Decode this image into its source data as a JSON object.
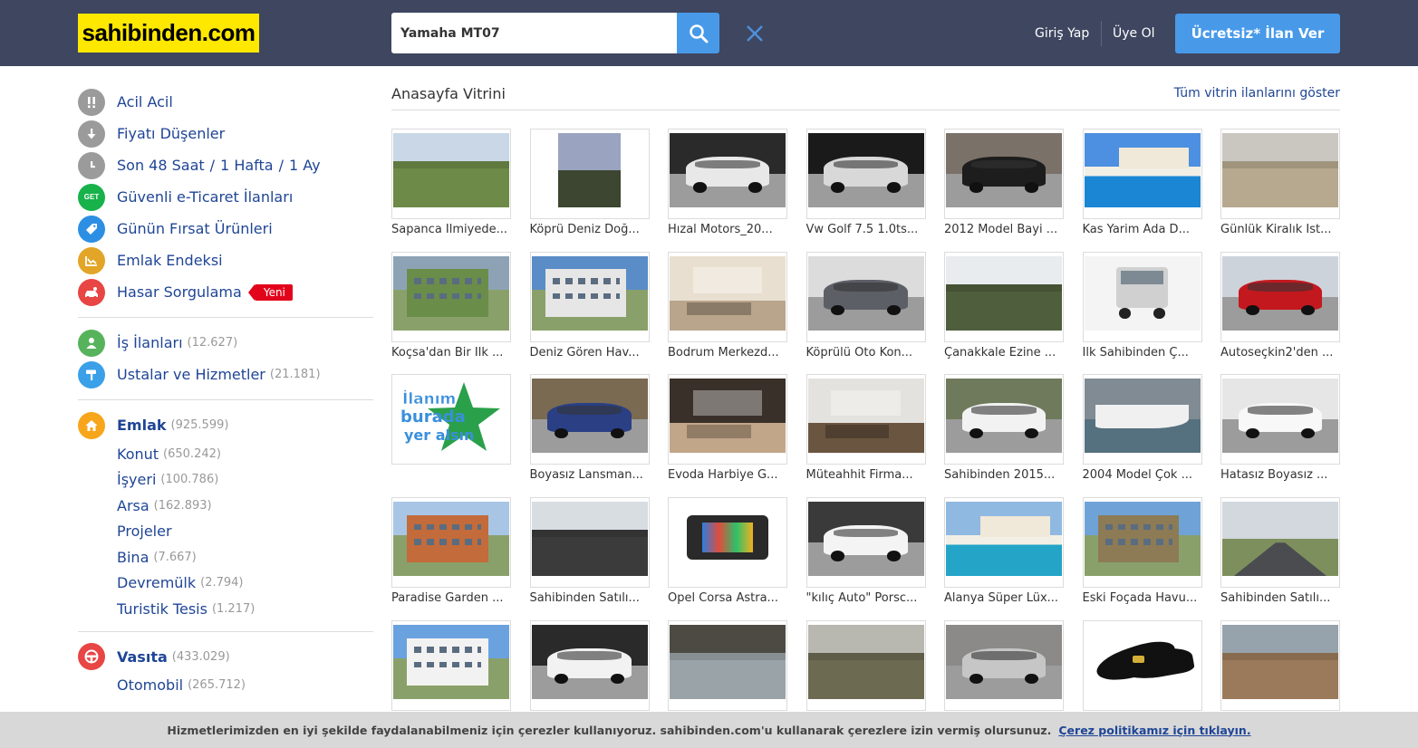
{
  "header": {
    "logo_text": "sahibinden.com",
    "search_value": "Yamaha MT07",
    "login_label": "Giriş Yap",
    "register_label": "Üye Ol",
    "cta_label": "Ücretsiz* İlan Ver"
  },
  "sidebar": {
    "quick_links": [
      {
        "label": "Acil Acil",
        "icon": "exclamation-icon",
        "color": "#9b9b9b"
      },
      {
        "label": "Fiyatı Düşenler",
        "icon": "arrow-down-icon",
        "color": "#9b9b9b"
      },
      {
        "label": "Son 48 Saat",
        "label2": "1 Hafta",
        "label3": "1 Ay",
        "icon": "clock-icon",
        "color": "#9b9b9b"
      },
      {
        "label": "Güvenli e-Ticaret İlanları",
        "icon": "get-icon",
        "icon_text": "GET",
        "color": "#17b24a"
      },
      {
        "label": "Günün Fırsat Ürünleri",
        "icon": "tag-icon",
        "color": "#2d8fe4"
      },
      {
        "label": "Emlak Endeksi",
        "icon": "chart-icon",
        "color": "#e2a527"
      },
      {
        "label": "Hasar Sorgulama",
        "icon": "car-damage-icon",
        "color": "#e84545",
        "badge": "Yeni"
      }
    ],
    "services": [
      {
        "label": "İş İlanları",
        "count": "(12.627)",
        "icon": "person-icon",
        "color": "#56b35c"
      },
      {
        "label": "Ustalar ve Hizmetler",
        "count": "(21.181)",
        "icon": "paint-roller-icon",
        "color": "#3aa0e8"
      }
    ],
    "emlak": {
      "label": "Emlak",
      "count": "(925.599)",
      "icon": "house-icon",
      "color": "#f7a61c",
      "subs": [
        {
          "label": "Konut",
          "count": "(650.242)"
        },
        {
          "label": "İşyeri",
          "count": "(100.786)"
        },
        {
          "label": "Arsa",
          "count": "(162.893)"
        },
        {
          "label": "Projeler",
          "count": ""
        },
        {
          "label": "Bina",
          "count": "(7.667)"
        },
        {
          "label": "Devremülk",
          "count": "(2.794)"
        },
        {
          "label": "Turistik Tesis",
          "count": "(1.217)"
        }
      ]
    },
    "vasita": {
      "label": "Vasıta",
      "count": "(433.029)",
      "icon": "steering-wheel-icon",
      "color": "#e84545",
      "subs": [
        {
          "label": "Otomobil",
          "count": "(265.712)"
        }
      ]
    }
  },
  "vitrin": {
    "title": "Anasayfa Vitrini",
    "show_all": "Tüm vitrin ilanlarını göster",
    "rows": [
      [
        {
          "title": "Sapanca Ilmiyede...",
          "kind": "land",
          "c1": "#c9d7e6",
          "c2": "#6d8a48"
        },
        {
          "title": "Köprü Deniz Doğ...",
          "kind": "sky",
          "c1": "#9aa3c0",
          "c2": "#3c4630"
        },
        {
          "title": "Hızal Motors_20...",
          "kind": "car",
          "c1": "#2a2a2a",
          "c2": "#e8e8e8"
        },
        {
          "title": "Vw Golf 7.5 1.0ts...",
          "kind": "car",
          "c1": "#1a1a1a",
          "c2": "#d8d8d8"
        },
        {
          "title": "2012 Model Bayi ...",
          "kind": "car",
          "c1": "#7a7168",
          "c2": "#1d1d1d"
        },
        {
          "title": "Kas Yarim Ada D...",
          "kind": "pool",
          "c1": "#4d8fe0",
          "c2": "#1a86d4"
        },
        {
          "title": "Günlük Kiralık İst...",
          "kind": "land",
          "c1": "#c9c7c0",
          "c2": "#b7a98f"
        }
      ],
      [
        {
          "title": "Koçsa'dan Bir Ilk ...",
          "kind": "building",
          "c1": "#8da3b5",
          "c2": "#6b8d4a"
        },
        {
          "title": "Deniz Gören Hav...",
          "kind": "building",
          "c1": "#5a8cc7",
          "c2": "#e6e6e6"
        },
        {
          "title": "Bodrum Merkezd...",
          "kind": "interior",
          "c1": "#e8dfd0",
          "c2": "#b9a58b"
        },
        {
          "title": "Köprülü Oto Kon...",
          "kind": "car",
          "c1": "#dcdcdc",
          "c2": "#5c5f66"
        },
        {
          "title": "Çanakkale Ezine ...",
          "kind": "land",
          "c1": "#e8ecef",
          "c2": "#4f5e3c"
        },
        {
          "title": "Ilk Sahibinden Ç...",
          "kind": "truck",
          "c1": "#f4f4f4",
          "c2": "#d0d0d0"
        },
        {
          "title": "Autoseçkin2'den ...",
          "kind": "car",
          "c1": "#cdd3da",
          "c2": "#c4181f"
        }
      ],
      [
        {
          "title": "",
          "kind": "placeholder",
          "c1": "#ffffff",
          "c2": "#2aa04a",
          "placeholder_lines": [
            "İlanım",
            "burada",
            "yer alsın"
          ]
        },
        {
          "title": "Boyasız Lansman...",
          "kind": "car",
          "c1": "#7a6a52",
          "c2": "#2a3f84"
        },
        {
          "title": "Evoda Harbiye G...",
          "kind": "interior",
          "c1": "#3a302a",
          "c2": "#c2a689"
        },
        {
          "title": "Müteahhit Firma...",
          "kind": "interior",
          "c1": "#e4e2de",
          "c2": "#6a5540"
        },
        {
          "title": "Sahibinden 2015...",
          "kind": "car",
          "c1": "#6f7a5c",
          "c2": "#f2f2f2"
        },
        {
          "title": "2004 Model Çok ...",
          "kind": "boat",
          "c1": "#808b94",
          "c2": "#f0f0f0"
        },
        {
          "title": "Hatasız Boyasız ...",
          "kind": "car",
          "c1": "#e6e6e6",
          "c2": "#f8f8f8"
        }
      ],
      [
        {
          "title": "Paradise Garden ...",
          "kind": "building",
          "c1": "#a9c5e6",
          "c2": "#c36b3a"
        },
        {
          "title": "Sahibinden Satılı...",
          "kind": "land",
          "c1": "#d8dde2",
          "c2": "#3b3b3b"
        },
        {
          "title": "Opel Corsa Astra...",
          "kind": "device",
          "c1": "#ffffff",
          "c2": "#2a2a2a"
        },
        {
          "title": "\"kılıç Auto\" Porsc...",
          "kind": "car",
          "c1": "#3a3a3a",
          "c2": "#f4f4f4"
        },
        {
          "title": "Alanya Süper Lüx...",
          "kind": "pool",
          "c1": "#8fb9e0",
          "c2": "#24a4c7"
        },
        {
          "title": "Eski Foçada Havu...",
          "kind": "building",
          "c1": "#6fa3d8",
          "c2": "#8d7b55"
        },
        {
          "title": "Sahibinden Satılı...",
          "kind": "road",
          "c1": "#d2d8de",
          "c2": "#4a4c4f"
        }
      ],
      [
        {
          "title": "",
          "kind": "building",
          "c1": "#6aa2e0",
          "c2": "#f2f2f2"
        },
        {
          "title": "",
          "kind": "car",
          "c1": "#2a2a2a",
          "c2": "#f2f2f2"
        },
        {
          "title": "",
          "kind": "land",
          "c1": "#4d4a44",
          "c2": "#9aa3a8"
        },
        {
          "title": "",
          "kind": "land",
          "c1": "#b9b8b0",
          "c2": "#6d6a52"
        },
        {
          "title": "",
          "kind": "car",
          "c1": "#8b8a88",
          "c2": "#c6c6c6"
        },
        {
          "title": "",
          "kind": "shoe",
          "c1": "#ffffff",
          "c2": "#111111"
        },
        {
          "title": "",
          "kind": "land",
          "c1": "#96a3ac",
          "c2": "#9b7a5b"
        }
      ]
    ]
  },
  "cookie": {
    "text": "Hizmetlerimizden en iyi şekilde faydalanabilmeniz için çerezler kullanıyoruz. sahibinden.com'u kullanarak çerezlere izin vermiş olursunuz.",
    "link": "Çerez politikamız için tıklayın."
  }
}
